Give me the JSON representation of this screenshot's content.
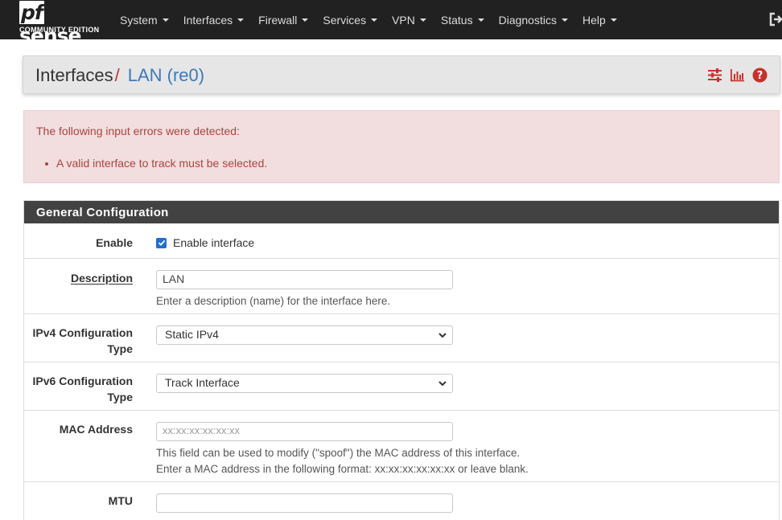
{
  "brand": {
    "name": "sense",
    "prefix": "pf",
    "edition": "COMMUNITY EDITION"
  },
  "nav": {
    "items": [
      {
        "label": "System"
      },
      {
        "label": "Interfaces"
      },
      {
        "label": "Firewall"
      },
      {
        "label": "Services"
      },
      {
        "label": "VPN"
      },
      {
        "label": "Status"
      },
      {
        "label": "Diagnostics"
      },
      {
        "label": "Help"
      }
    ],
    "logout_icon": "logout-icon"
  },
  "breadcrumb": {
    "section": "Interfaces",
    "separator": "/",
    "page": "LAN (re0)"
  },
  "header_icons": [
    "settings-sliders-icon",
    "bar-chart-icon",
    "help-circle-icon"
  ],
  "colors": {
    "navbar": "#212121",
    "accent": "#c7312c",
    "link": "#3d7ab8",
    "alert_bg": "#f2dede",
    "alert_text": "#a94442",
    "panel_head": "#424242",
    "checkbox": "#1f6fd1"
  },
  "alert": {
    "heading": "The following input errors were detected:",
    "errors": [
      "A valid interface to track must be selected."
    ]
  },
  "panel": {
    "title": "General Configuration",
    "enable": {
      "label": "Enable",
      "checkbox_label": "Enable interface",
      "checked": true
    },
    "description": {
      "label": "Description",
      "value": "LAN",
      "help": "Enter a description (name) for the interface here."
    },
    "ipv4": {
      "label_line1": "IPv4 Configuration",
      "label_line2": "Type",
      "selected": "Static IPv4"
    },
    "ipv6": {
      "label_line1": "IPv6 Configuration",
      "label_line2": "Type",
      "selected": "Track Interface"
    },
    "mac": {
      "label": "MAC Address",
      "placeholder": "xx:xx:xx:xx:xx:xx",
      "help_line1": "This field can be used to modify (\"spoof\") the MAC address of this interface.",
      "help_line2": "Enter a MAC address in the following format: xx:xx:xx:xx:xx:xx or leave blank."
    },
    "mtu": {
      "label": "MTU",
      "value": ""
    }
  }
}
